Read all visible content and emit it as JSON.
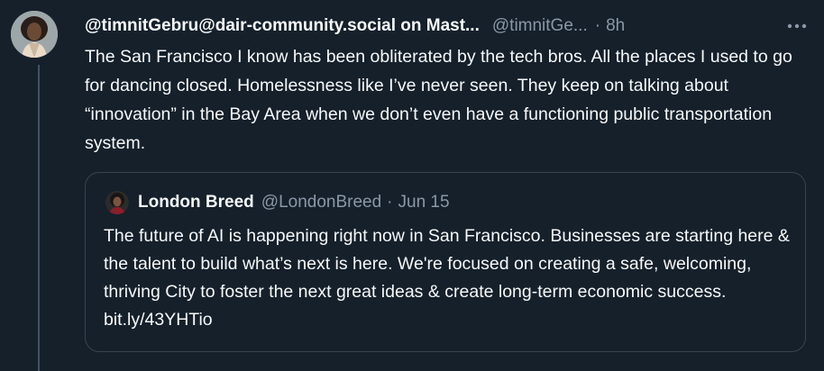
{
  "tweet": {
    "author_name": "@timnitGebru@dair-community.social on Mast...",
    "handle": "@timnitGe...",
    "separator": "·",
    "time": "8h",
    "text": "The San Francisco I know has been obliterated by the tech bros. All the places I used to go for dancing closed. Homelessness like I’ve never seen. They keep on talking about “innovation” in the Bay Area when we don’t even have a functioning public transportation system."
  },
  "quoted_tweet": {
    "author_name": "London Breed",
    "handle": "@LondonBreed",
    "separator": "·",
    "date": "Jun 15",
    "text": "The future of AI is happening right now in San Francisco. Businesses are starting here & the talent to build what’s next is here. We're focused on creating a safe, welcoming, thriving City to foster the next great ideas & create long-term economic success. bit.ly/43YHTio"
  },
  "icons": {
    "more": "more-horizontal-icon"
  },
  "colors": {
    "background": "#15202b",
    "primary_text": "#f7f9f9",
    "secondary_text": "#8b98a5",
    "border": "#38444d"
  }
}
